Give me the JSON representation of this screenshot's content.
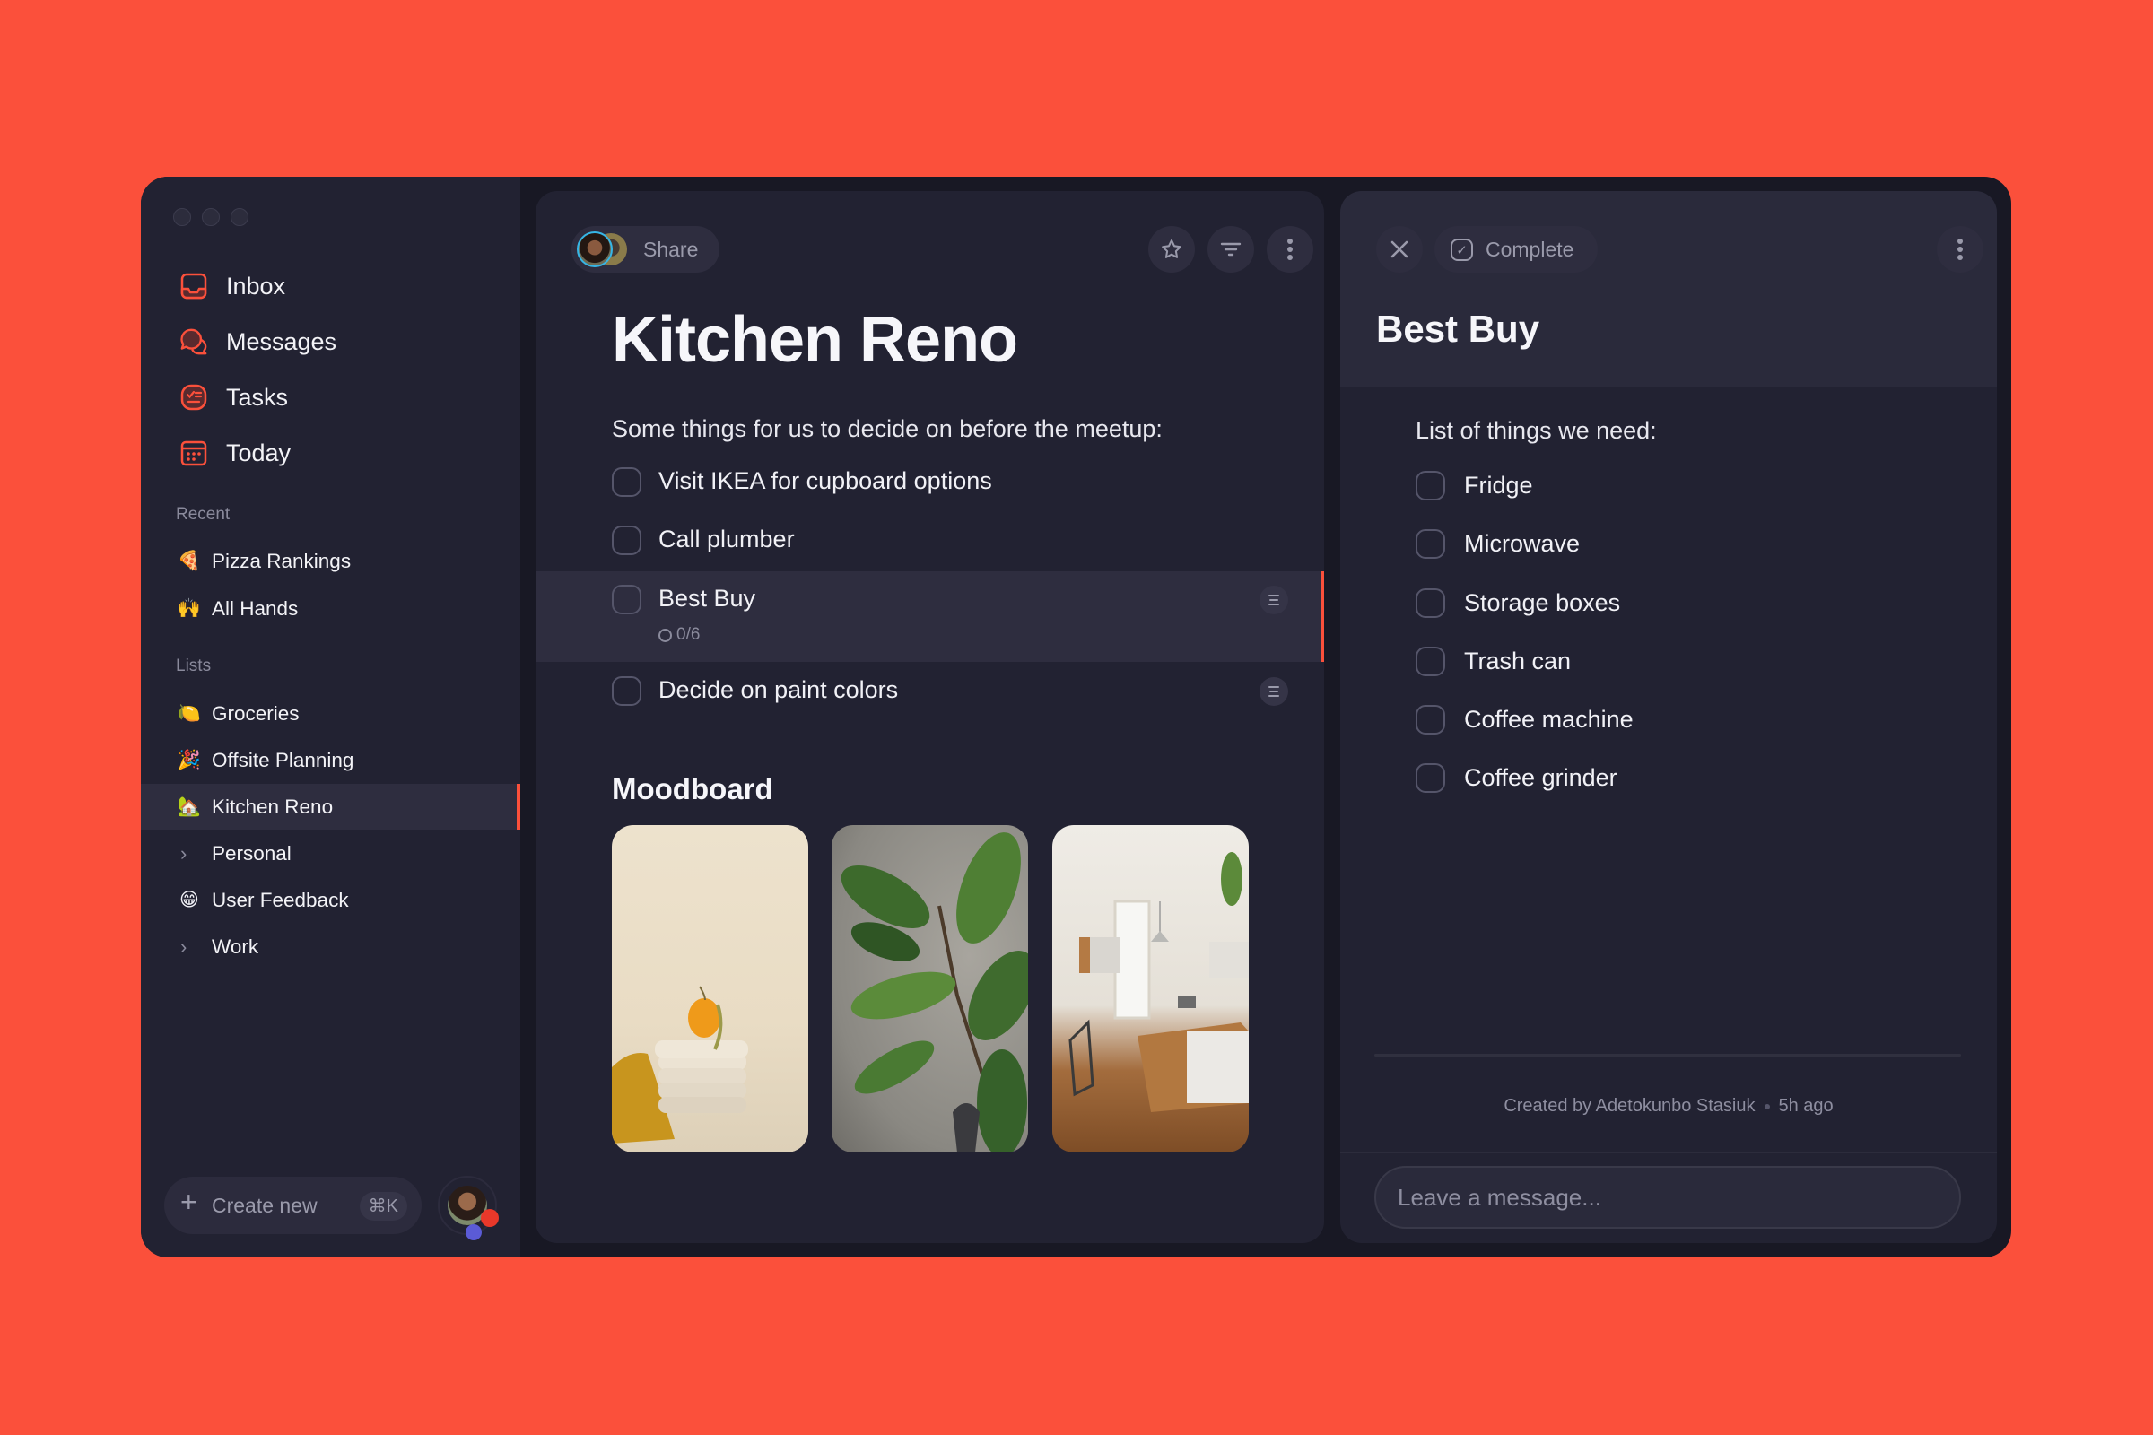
{
  "theme": {
    "accent": "#fb503b",
    "background": "#fb503b",
    "window": "#181824",
    "panel": "#222232"
  },
  "window_controls": [
    "close",
    "minimize",
    "maximize"
  ],
  "sidebar": {
    "nav": [
      {
        "label": "Inbox",
        "icon": "inbox-icon"
      },
      {
        "label": "Messages",
        "icon": "messages-icon"
      },
      {
        "label": "Tasks",
        "icon": "tasks-icon"
      },
      {
        "label": "Today",
        "icon": "calendar-icon"
      }
    ],
    "recent_label": "Recent",
    "recent": [
      {
        "emoji": "🍕",
        "label": "Pizza Rankings"
      },
      {
        "emoji": "🙌",
        "label": "All Hands"
      }
    ],
    "lists_label": "Lists",
    "lists": [
      {
        "emoji": "🍋",
        "label": "Groceries",
        "active": false
      },
      {
        "emoji": "🎉",
        "label": "Offsite Planning",
        "active": false
      },
      {
        "emoji": "🏡",
        "label": "Kitchen Reno",
        "active": true
      },
      {
        "chevron": "›",
        "label": "Personal",
        "active": false
      },
      {
        "emoji": "😁",
        "label": "User Feedback",
        "active": false
      },
      {
        "chevron": "›",
        "label": "Work",
        "active": false
      }
    ],
    "create_new": {
      "icon": "+",
      "label": "Create new",
      "shortcut": "⌘K"
    }
  },
  "main": {
    "share_label": "Share",
    "title": "Kitchen Reno",
    "intro": "Some things for us to decide on before the meetup:",
    "tasks": [
      {
        "label": "Visit IKEA for cupboard options",
        "has_notes": false
      },
      {
        "label": "Call plumber",
        "has_notes": false
      },
      {
        "label": "Best Buy",
        "subtasks": "0/6",
        "has_notes": true,
        "selected": true
      },
      {
        "label": "Decide on paint colors",
        "has_notes": true
      }
    ],
    "moodboard": {
      "title": "Moodboard",
      "images": [
        {
          "alt": "Orange on stacked plates with mustard cloth"
        },
        {
          "alt": "Fiddle leaf fig plant against concrete wall"
        },
        {
          "alt": "Bright kitchen with wooden island and chair"
        }
      ]
    }
  },
  "detail": {
    "complete_label": "Complete",
    "title": "Best Buy",
    "intro": "List of things we need:",
    "items": [
      "Fridge",
      "Microwave",
      "Storage boxes",
      "Trash can",
      "Coffee machine",
      "Coffee grinder"
    ],
    "created_by": "Created by Adetokunbo Stasiuk",
    "created_ago": "5h ago",
    "message_placeholder": "Leave a message..."
  }
}
